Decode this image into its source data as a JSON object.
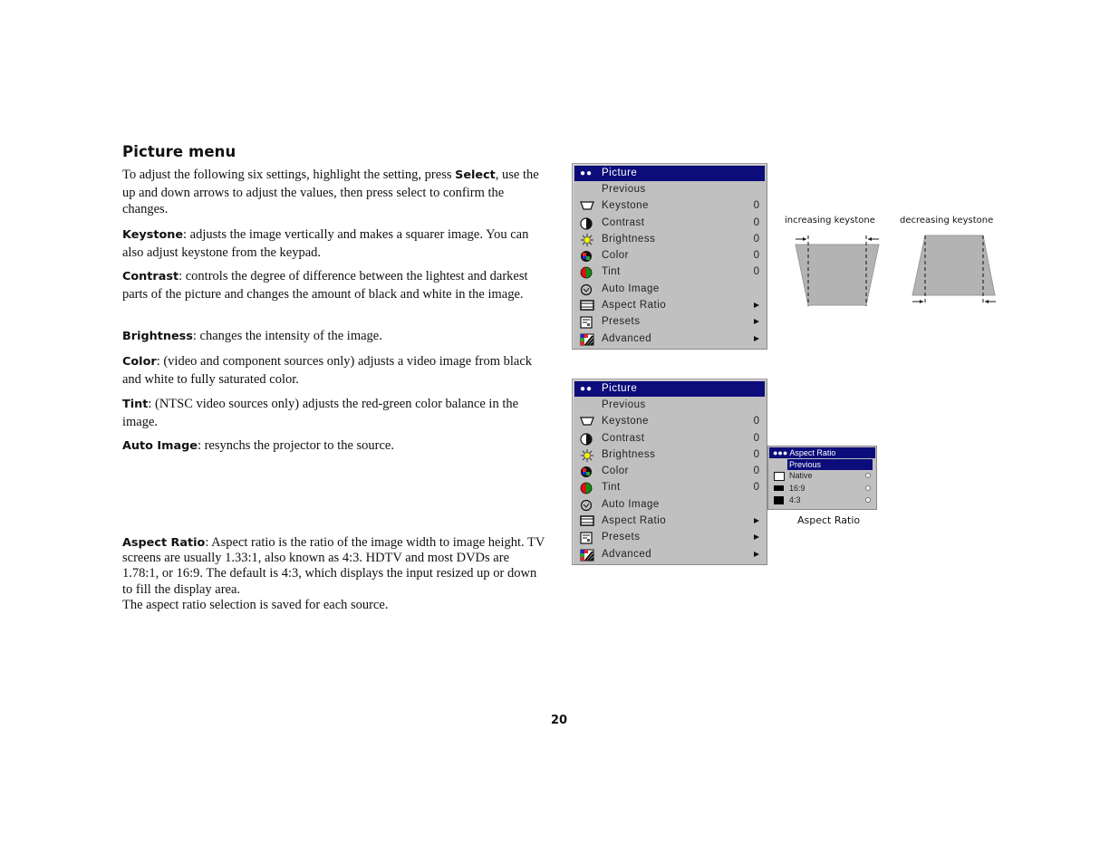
{
  "heading": "Picture menu",
  "intro": {
    "pre": "To adjust the following six settings, highlight the setting, press ",
    "bold": "Select",
    "post": ", use the up and down arrows to adjust the values, then press select to confirm the changes."
  },
  "definitions": [
    {
      "term": "Keystone",
      "text": ": adjusts the image vertically and makes a squarer image. You can also adjust keystone from the keypad."
    },
    {
      "term": "Contrast",
      "text": ": controls the degree of difference between the lightest and darkest parts of the picture and changes the amount of black and white in the image."
    },
    {
      "term": "Brightness",
      "text": ": changes the intensity of the image."
    },
    {
      "term": "Color",
      "text": ": (video and component sources only) adjusts a video image from black and white to fully saturated color."
    },
    {
      "term": "Tint",
      "text": ": (NTSC video sources only) adjusts the red-green color balance in the image."
    },
    {
      "term": "Auto Image",
      "text": ": resynchs the projector to the source."
    }
  ],
  "aspect": {
    "term": "Aspect Ratio",
    "text": ": Aspect ratio is the ratio of the image width to image height. TV screens are usually 1.33:1, also known as 4:3. HDTV and most DVDs are 1.78:1, or 16:9. The default is 4:3, which displays the input resized up or down to fill the display area.",
    "note": "The aspect ratio selection is saved for each source."
  },
  "menu": {
    "header": "Picture",
    "header_dots": "●●",
    "items": [
      {
        "label": "Previous",
        "icon": "none",
        "value": "",
        "submenu": false
      },
      {
        "label": "Keystone",
        "icon": "keystone-icon",
        "value": "0",
        "submenu": false
      },
      {
        "label": "Contrast",
        "icon": "contrast-icon",
        "value": "0",
        "submenu": false
      },
      {
        "label": "Brightness",
        "icon": "brightness-icon",
        "value": "0",
        "submenu": false
      },
      {
        "label": "Color",
        "icon": "color-icon",
        "value": "0",
        "submenu": false
      },
      {
        "label": "Tint",
        "icon": "tint-icon",
        "value": "0",
        "submenu": false
      },
      {
        "label": "Auto Image",
        "icon": "auto-image-icon",
        "value": "",
        "submenu": false
      },
      {
        "label": "Aspect Ratio",
        "icon": "aspect-ratio-icon",
        "value": "",
        "submenu": true
      },
      {
        "label": "Presets",
        "icon": "presets-icon",
        "value": "",
        "submenu": true
      },
      {
        "label": "Advanced",
        "icon": "advanced-icon",
        "value": "",
        "submenu": true
      }
    ]
  },
  "keystone_diagram": {
    "increasing": "increasing keystone",
    "decreasing": "decreasing keystone"
  },
  "aspect_submenu": {
    "header": "Aspect Ratio",
    "header_dots": "●●●",
    "previous": "Previous",
    "options": [
      {
        "label": "Native",
        "swatch": "#ffffff"
      },
      {
        "label": "16:9",
        "swatch": "#000000"
      },
      {
        "label": "4:3",
        "swatch": "#000000"
      }
    ],
    "caption": "Aspect Ratio"
  },
  "page_number": "20",
  "colors": {
    "menu_bg": "#c0c0c0",
    "highlight": "#0c0c7a"
  }
}
